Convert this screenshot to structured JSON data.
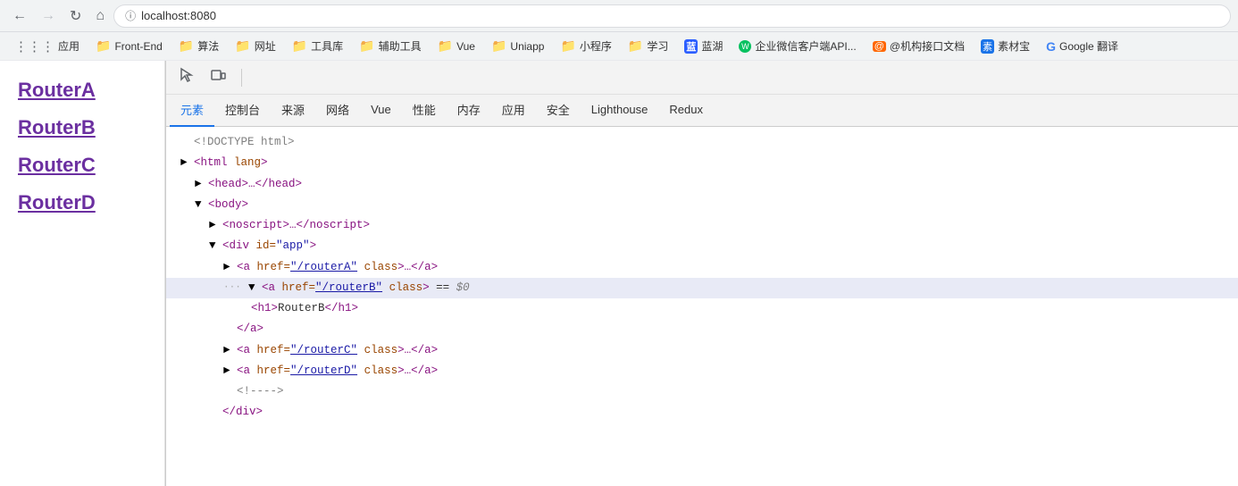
{
  "browser": {
    "url": "localhost:8080",
    "back_disabled": false,
    "forward_disabled": true
  },
  "bookmarks": [
    {
      "label": "应用",
      "type": "apps"
    },
    {
      "label": "Front-End",
      "type": "folder"
    },
    {
      "label": "算法",
      "type": "folder"
    },
    {
      "label": "网址",
      "type": "folder"
    },
    {
      "label": "工具库",
      "type": "folder"
    },
    {
      "label": "辅助工具",
      "type": "folder"
    },
    {
      "label": "Vue",
      "type": "folder"
    },
    {
      "label": "Uniapp",
      "type": "folder"
    },
    {
      "label": "小程序",
      "type": "folder"
    },
    {
      "label": "学习",
      "type": "folder"
    },
    {
      "label": "蓝湖",
      "type": "favicon"
    },
    {
      "label": "企业微信客户端API...",
      "type": "favicon"
    },
    {
      "label": "@机构接口文档",
      "type": "favicon"
    },
    {
      "label": "素材宝",
      "type": "favicon"
    },
    {
      "label": "Google 翻译",
      "type": "favicon"
    }
  ],
  "page": {
    "links": [
      {
        "label": "RouterA",
        "href": "/routerA"
      },
      {
        "label": "RouterB",
        "href": "/routerB"
      },
      {
        "label": "RouterC",
        "href": "/routerC"
      },
      {
        "label": "RouterD",
        "href": "/routerD"
      }
    ]
  },
  "devtools": {
    "tabs": [
      {
        "label": "元素",
        "active": true
      },
      {
        "label": "控制台",
        "active": false
      },
      {
        "label": "来源",
        "active": false
      },
      {
        "label": "网络",
        "active": false
      },
      {
        "label": "Vue",
        "active": false
      },
      {
        "label": "性能",
        "active": false
      },
      {
        "label": "内存",
        "active": false
      },
      {
        "label": "应用",
        "active": false
      },
      {
        "label": "安全",
        "active": false
      },
      {
        "label": "Lighthouse",
        "active": false
      },
      {
        "label": "Redux",
        "active": false
      }
    ],
    "html_tree": [
      {
        "indent": 1,
        "content": "doctype",
        "text": "<!DOCTYPE html>"
      },
      {
        "indent": 1,
        "content": "tag-line",
        "text": "<html lang>"
      },
      {
        "indent": 2,
        "content": "collapsed",
        "triangle": "▶",
        "text": "<head>…</head>"
      },
      {
        "indent": 2,
        "content": "expanded",
        "triangle": "▼",
        "text": "<body>"
      },
      {
        "indent": 3,
        "content": "collapsed",
        "triangle": "▶",
        "text": "<noscript>…</noscript>"
      },
      {
        "indent": 3,
        "content": "expanded2",
        "triangle": "▼",
        "text": "<div id=\"app\">"
      },
      {
        "indent": 4,
        "content": "collapsed",
        "triangle": "▶",
        "text": "<a href=\"/routerA\" class>…</a>"
      },
      {
        "indent": 4,
        "content": "highlighted",
        "triangle": "▼",
        "text": "<a href=\"/routerB\" class> == $0",
        "dots": true
      },
      {
        "indent": 5,
        "content": "normal",
        "text": "<h1>RouterB</h1>"
      },
      {
        "indent": 4,
        "content": "normal",
        "text": "</a>"
      },
      {
        "indent": 4,
        "content": "collapsed",
        "triangle": "▶",
        "text": "<a href=\"/routerC\" class>…</a>"
      },
      {
        "indent": 4,
        "content": "collapsed",
        "triangle": "▶",
        "text": "<a href=\"/routerD\" class>…</a>"
      },
      {
        "indent": 4,
        "content": "normal",
        "text": "<!---->"
      },
      {
        "indent": 3,
        "content": "normal",
        "text": "</div>"
      }
    ]
  }
}
